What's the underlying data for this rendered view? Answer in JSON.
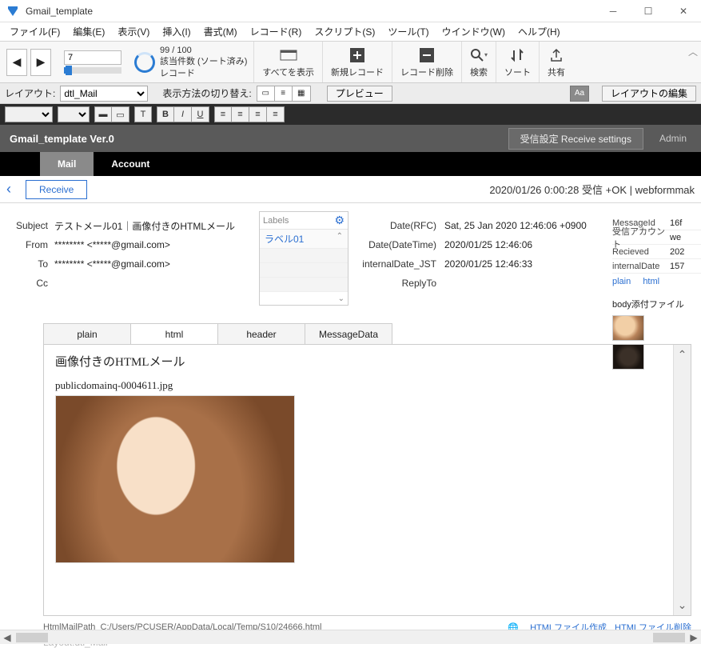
{
  "window": {
    "title": "Gmail_template"
  },
  "menu": {
    "file": "ファイル(F)",
    "edit": "編集(E)",
    "view": "表示(V)",
    "insert": "挿入(I)",
    "format": "書式(M)",
    "record": "レコード(R)",
    "script": "スクリプト(S)",
    "tool": "ツール(T)",
    "window": "ウインドウ(W)",
    "help": "ヘルプ(H)"
  },
  "toolbar": {
    "record_field": "7",
    "count_line1": "99 / 100",
    "count_line2": "該当件数 (ソート済み)",
    "count_line3": "レコード",
    "show_all": "すべてを表示",
    "new_record": "新規レコード",
    "delete_record": "レコード削除",
    "search": "検索",
    "sort": "ソート",
    "share": "共有"
  },
  "layoutbar": {
    "layout_label": "レイアウト:",
    "layout_value": "dtl_Mail",
    "view_switch": "表示方法の切り替え:",
    "preview": "プレビュー",
    "edit_layout": "レイアウトの編集",
    "aa": "Aa"
  },
  "darkheader": {
    "version": "Gmail_template Ver.0",
    "receive_settings": "受信設定 Receive settings",
    "admin": "Admin"
  },
  "tabs": {
    "mail": "Mail",
    "account": "Account"
  },
  "actionrow": {
    "receive": "Receive",
    "status": "2020/01/26 0:00:28 受信 +OK | webformmak"
  },
  "mail": {
    "subject_label": "Subject",
    "subject": "テストメール01｜画像付きのHTMLメール",
    "from_label": "From",
    "from": "******** <*****@gmail.com>",
    "to_label": "To",
    "to": "******** <*****@gmail.com>",
    "cc_label": "Cc",
    "cc": ""
  },
  "labels": {
    "header": "Labels",
    "item1": "ラベル01"
  },
  "meta": {
    "date_rfc_label": "Date(RFC)",
    "date_rfc": "Sat, 25 Jan 2020 12:46:06 +0900",
    "date_dt_label": "Date(DateTime)",
    "date_dt": "2020/01/25 12:46:06",
    "internal_label": "internalDate_JST",
    "internal": "2020/01/25 12:46:33",
    "replyto_label": "ReplyTo",
    "replyto": ""
  },
  "side": {
    "messageid_label": "MessageId",
    "messageid": "16f",
    "account_label": "受信アカウント",
    "account": "we",
    "received_label": "Recieved",
    "received": "202",
    "internal_label": "internalDate",
    "internal": "157",
    "plain": "plain",
    "html": "html",
    "attach_label": "body添付ファイル"
  },
  "bodytabs": {
    "plain": "plain",
    "html": "html",
    "header": "header",
    "msgdata": "MessageData"
  },
  "body": {
    "title": "画像付きのHTMLメール",
    "imgname": "publicdomainq-0004611.jpg",
    "path_label": "HtmlMailPath",
    "path": "C:/Users/PCUSER/AppData/Local/Temp/S10/24666.html",
    "link_create": "HTMLファイル作成",
    "link_delete": "HTMLファイル削除"
  },
  "footer": {
    "layout_hint": "Layout:dtl_Mail"
  }
}
